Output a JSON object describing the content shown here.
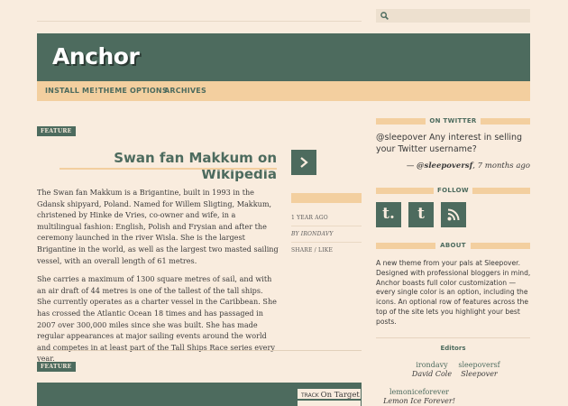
{
  "site": {
    "title": "Anchor"
  },
  "nav": {
    "items": [
      "INSTALL ME!",
      "THEME OPTIONS",
      "ARCHIVES"
    ]
  },
  "post": {
    "badge": "FEATURE",
    "title": "Swan fan Makkum on Wikipedia",
    "paragraphs": [
      "The Swan fan Makkum is a Brigantine, built in 1993 in the Gdansk shipyard, Poland. Named for Willem Sligting, Makkum, christened by Hinke de Vries, co-owner and wife, in a multilingual fashion: English, Polish and Frysian and after the ceremony launched in the river Wisla. She is the largest Brigantine in the world, as well as the largest two masted sailing vessel, with an overall length of 61 metres.",
      "She carries a maximum of 1300 square metres of sail, and with an air draft of 44 metres is one of the tallest of the tall ships. She currently operates as a charter vessel in the Caribbean. She has crossed the Atlantic Ocean 18 times and has passaged in 2007 over 300,000 miles since she was built. She has made regular appearances at major sailing events around the world and competes in at least part of the Tall Ships Race series every year."
    ],
    "meta": {
      "date": "1 YEAR AGO",
      "author": "By IRONDAVY",
      "actions": "SHARE / LIKE"
    }
  },
  "post2": {
    "badge": "FEATURE",
    "track_label": "TRACK",
    "track_title": "On Target"
  },
  "sidebar": {
    "twitter": {
      "heading": "ON TWITTER",
      "tweet": "@sleepover Any interest in selling your Twitter username?",
      "dash": "— ",
      "handle": "@sleepoversf",
      "time": ", 7 months ago"
    },
    "follow": {
      "heading": "FOLLOW",
      "icons": [
        "tumblr-icon",
        "twitter-icon",
        "rss-icon"
      ],
      "tumblr_glyph": "t.",
      "twitter_glyph": "t"
    },
    "about": {
      "heading": "ABOUT",
      "text": "A new theme from your pals at Sleepover. Designed with professional bloggers in mind, Anchor boasts full color customization — every single color is an option, including the icons. An optional row of features across the top of the site lets you highlight your best posts."
    },
    "editors": {
      "heading": "Editors",
      "list": [
        {
          "user": "irondavy",
          "name": "David Cole"
        },
        {
          "user": "sleepoversf",
          "name": "Sleepover"
        },
        {
          "user": "lemoniceforever",
          "name": "Lemon Ice Forever!"
        }
      ]
    }
  },
  "colors": {
    "background": "#f9ecde",
    "primary": "#4d6b5e",
    "accent": "#f3cf9f"
  }
}
